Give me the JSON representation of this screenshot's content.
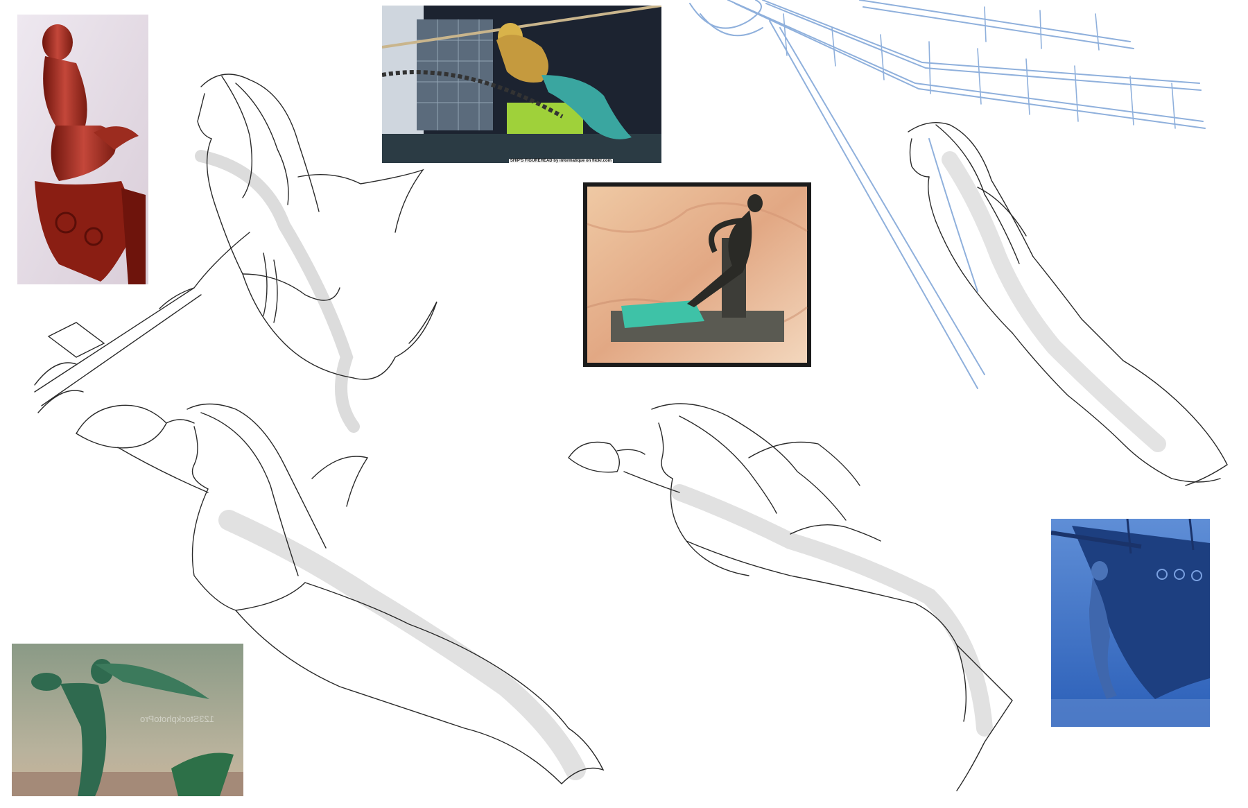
{
  "board": {
    "background": "#ffffff",
    "description_free": true
  },
  "references": {
    "red_figurehead": {
      "palette": [
        "#8c1f14",
        "#c94a38",
        "#e8e0ea"
      ]
    },
    "harbor_figurehead": {
      "caption": "SHIP'S FIGUREHEAD by informatique on flickr.com",
      "palette": [
        "#1c2330",
        "#d9b34a",
        "#3aa6a0",
        "#9fd13a"
      ]
    },
    "bronze_statue": {
      "palette": [
        "#1b1b1b",
        "#e6b892",
        "#3ec2a7",
        "#5a5a52"
      ]
    },
    "green_statue": {
      "watermark": "123StockphotoPro",
      "palette": [
        "#7b8f74",
        "#2f6a4f",
        "#c9b49a"
      ]
    },
    "blue_ship_figurehead": {
      "palette": [
        "#2b5fb8",
        "#6a95d8",
        "#1d3f80"
      ]
    }
  },
  "sketches": {
    "pencil_color": "#2a2a2a",
    "shade_color": "#9a9a9a",
    "construction_color": "#8fb0dc"
  }
}
